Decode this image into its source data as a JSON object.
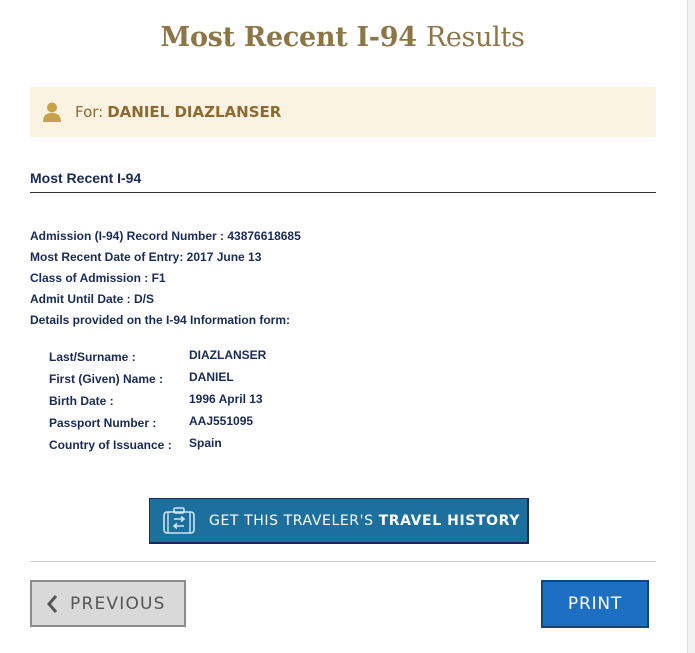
{
  "title": {
    "bold": "Most Recent I-94",
    "light": "Results"
  },
  "banner": {
    "for_label": "For:",
    "name": "DANIEL DIAZLANSER",
    "icon": "user-icon"
  },
  "section_heading": "Most Recent I-94",
  "record": {
    "admission_number": "Admission (I-94) Record Number : 43876618685",
    "entry_date": "Most Recent Date of Entry: 2017 June 13",
    "class_of_admission": "Class of Admission : F1",
    "admit_until": "Admit Until Date : D/S",
    "details_intro": "Details provided on the I-94 Information form:"
  },
  "details": [
    {
      "label": "Last/Surname :",
      "value": "DIAZLANSER"
    },
    {
      "label": "First (Given) Name :",
      "value": "DANIEL"
    },
    {
      "label": "Birth Date :",
      "value": "1996 April 13"
    },
    {
      "label": "Passport Number :",
      "value": "AAJ551095"
    },
    {
      "label": "Country of Issuance :",
      "value": "Spain"
    }
  ],
  "travel_history_button": {
    "light": "GET THIS TRAVELER'S",
    "bold": "TRAVEL HISTORY",
    "icon": "suitcase-icon"
  },
  "previous_button": {
    "label": "PREVIOUS",
    "icon": "chevron-left-icon"
  },
  "print_button": {
    "label": "PRINT"
  },
  "colors": {
    "title": "#8c7648",
    "banner_bg": "#fbf3e1",
    "navy_text": "#1a2a57",
    "travel_button": "#1d6f9e",
    "print_button": "#1d6fc4"
  }
}
